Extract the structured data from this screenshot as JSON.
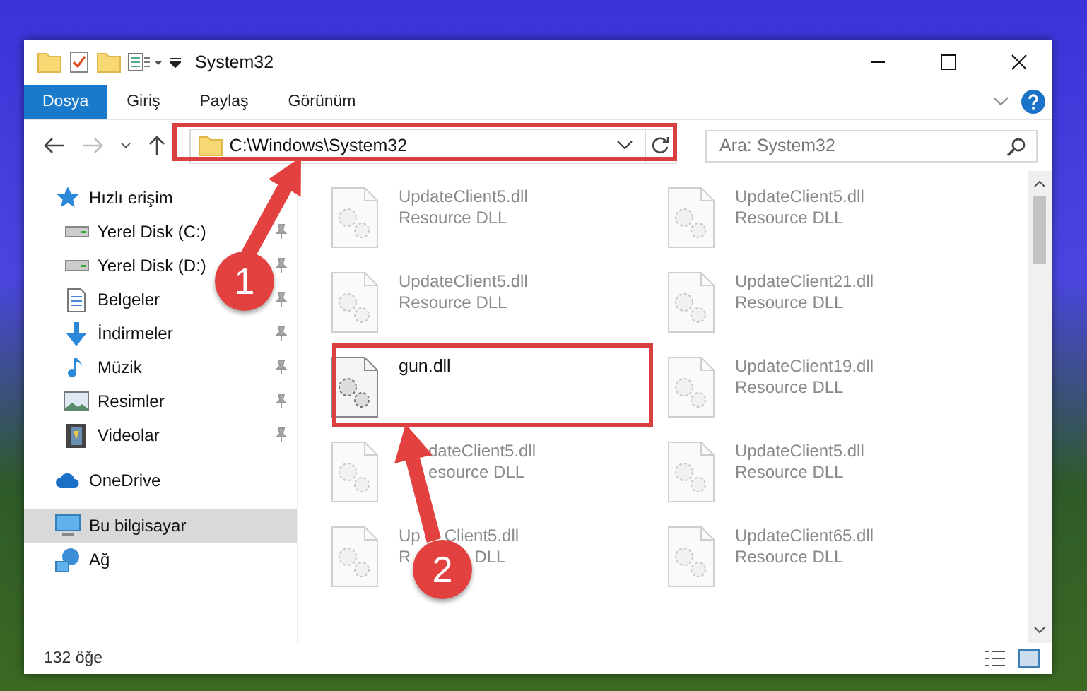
{
  "window": {
    "title": "System32"
  },
  "ribbon_tabs": [
    {
      "label": "Dosya",
      "selected": true
    },
    {
      "label": "Giriş",
      "selected": false
    },
    {
      "label": "Paylaş",
      "selected": false
    },
    {
      "label": "Görünüm",
      "selected": false
    }
  ],
  "address_bar": {
    "path": "C:\\Windows\\System32"
  },
  "search": {
    "placeholder": "Ara: System32"
  },
  "sidebar": {
    "items": [
      {
        "label": "Hızlı erişim",
        "kind": "star",
        "selected": false,
        "children": [
          {
            "label": "Yerel Disk (C:)",
            "kind": "drive",
            "selected": false,
            "pinned": true
          },
          {
            "label": "Yerel Disk (D:)",
            "kind": "drive",
            "selected": false,
            "pinned": true
          },
          {
            "label": "Belgeler",
            "kind": "doc",
            "selected": false,
            "pinned": true
          },
          {
            "label": "İndirmeler",
            "kind": "download",
            "selected": false,
            "pinned": true
          },
          {
            "label": "Müzik",
            "kind": "music",
            "selected": false,
            "pinned": true
          },
          {
            "label": "Resimler",
            "kind": "picture",
            "selected": false,
            "pinned": true
          },
          {
            "label": "Videolar",
            "kind": "film",
            "selected": false,
            "pinned": true
          }
        ]
      },
      {
        "label": "OneDrive",
        "kind": "cloud",
        "selected": false
      },
      {
        "label": "Bu bilgisayar",
        "kind": "monitor",
        "selected": true
      },
      {
        "label": "Ağ",
        "kind": "network",
        "selected": false
      }
    ]
  },
  "files": [
    {
      "kind": "plain",
      "name": "UpdateClient5.dll",
      "type": "Resource DLL",
      "faded": true
    },
    {
      "kind": "plain",
      "name": "UpdateClient5.dll",
      "type": "Resource DLL",
      "faded": true
    },
    {
      "kind": "plain",
      "name": "UpdateClient5.dll",
      "type": "Resource DLL",
      "faded": true
    },
    {
      "kind": "plain",
      "name": "UpdateClient21.dll",
      "type": "Resource DLL",
      "faded": true
    },
    {
      "kind": "highlighted",
      "name": "gun.dll",
      "faded": false
    },
    {
      "kind": "plain",
      "name": "UpdateClient19.dll",
      "type": "Resource DLL",
      "faded": true
    },
    {
      "kind": "behind_arrow",
      "name": "dateClient5.dll",
      "type": "esource DLL",
      "faded": true
    },
    {
      "kind": "plain",
      "name": "UpdateClient5.dll",
      "type": "Resource DLL",
      "faded": true
    },
    {
      "kind": "behind_badge",
      "name_parts": [
        "Up",
        "Client5.dll"
      ],
      "type_parts": [
        "R",
        "DLL"
      ],
      "faded": true
    },
    {
      "kind": "plain",
      "name": "UpdateClient65.dll",
      "type": "Resource DLL",
      "faded": true
    }
  ],
  "status_bar": {
    "item_count": "132 öğe"
  },
  "annotations": [
    {
      "number": "1"
    },
    {
      "number": "2"
    }
  ]
}
